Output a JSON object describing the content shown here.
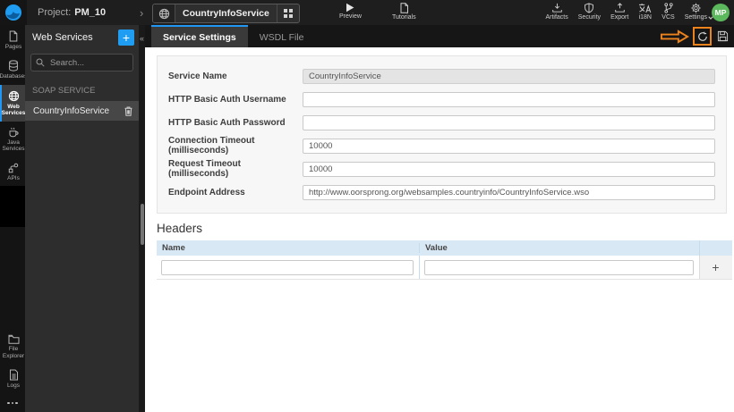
{
  "topbar": {
    "project_prefix": "Project:",
    "project_name": "PM_10",
    "service_name": "CountryInfoService",
    "preview_label": "Preview",
    "tutorials_label": "Tutorials",
    "actions": [
      {
        "label": "Artifacts"
      },
      {
        "label": "Security"
      },
      {
        "label": "Export"
      },
      {
        "label": "i18N"
      },
      {
        "label": "VCS"
      },
      {
        "label": "Settings"
      }
    ],
    "avatar_initials": "MP",
    "avatar_color": "#5cb85c"
  },
  "sidebar": {
    "items": [
      {
        "label": "Pages"
      },
      {
        "label": "Databases"
      },
      {
        "label": "Web Services",
        "active": true
      },
      {
        "label": "Java Services"
      },
      {
        "label": "APIs"
      }
    ],
    "bottom_items": [
      {
        "label": "File Explorer"
      },
      {
        "label": "Logs"
      }
    ]
  },
  "panel": {
    "title": "Web Services",
    "add_label": "+",
    "search_placeholder": "Search...",
    "section_label": "SOAP SERVICE",
    "items": [
      {
        "label": "CountryInfoService"
      }
    ],
    "collapse_glyph": "«"
  },
  "tabs": [
    {
      "label": "Service Settings",
      "active": true
    },
    {
      "label": "WSDL File"
    }
  ],
  "form": {
    "fields": [
      {
        "label": "Service Name",
        "value": "CountryInfoService",
        "disabled": true
      },
      {
        "label": "HTTP Basic Auth Username",
        "value": ""
      },
      {
        "label": "HTTP Basic Auth Password",
        "value": ""
      },
      {
        "label": "Connection Timeout (milliseconds)",
        "value": "10000"
      },
      {
        "label": "Request Timeout (milliseconds)",
        "value": "10000"
      },
      {
        "label": "Endpoint Address",
        "value": "http://www.oorsprong.org/websamples.countryinfo/CountryInfoService.wso"
      }
    ]
  },
  "headers_section": {
    "title": "Headers",
    "columns": [
      "Name",
      "Value"
    ],
    "add_label": "+",
    "rows": [
      {
        "name": "",
        "value": ""
      }
    ]
  },
  "colors": {
    "accent_blue": "#2196f3",
    "annotation_orange": "#ed831d",
    "table_header_blue": "#d8e8f5"
  }
}
